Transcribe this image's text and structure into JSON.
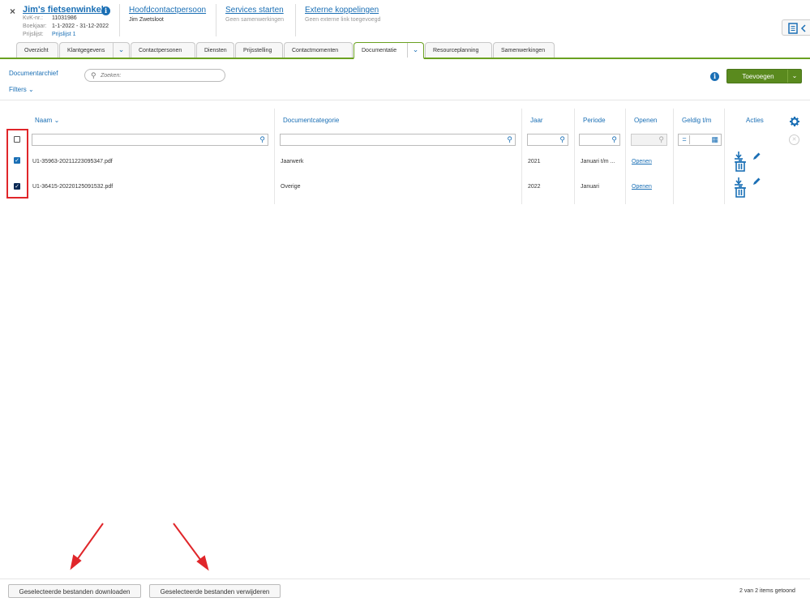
{
  "client": {
    "name": "Jim's fietsenwinkel",
    "kvk_label": "KvK-nr.:",
    "kvk_value": "11031986",
    "boekjaar_label": "Boekjaar:",
    "boekjaar_value": "1-1-2022 - 31-12-2022",
    "prijslijst_label": "Prijslijst:",
    "prijslijst_value": "Prijslijst 1"
  },
  "header": {
    "contact_title": "Hoofdcontactpersoon",
    "contact_name": "Jim Zwetsloot",
    "services_title": "Services starten",
    "services_sub": "Geen samenwerkingen",
    "external_title": "Externe koppelingen",
    "external_sub": "Geen externe link toegevoegd"
  },
  "tabs": [
    {
      "label": "Overzicht"
    },
    {
      "label": "Klantgegevens"
    },
    {
      "label": "Contactpersonen"
    },
    {
      "label": "Diensten"
    },
    {
      "label": "Prijsstelling"
    },
    {
      "label": "Contactmomenten"
    },
    {
      "label": "Documentatie"
    },
    {
      "label": "Resourceplanning"
    },
    {
      "label": "Samenwerkingen"
    }
  ],
  "toolbar": {
    "archive_label": "Documentarchief",
    "search_placeholder": "Zoeken:",
    "filters_label": "Filters",
    "add_label": "Toevoegen"
  },
  "table": {
    "columns": {
      "naam": "Naam",
      "categorie": "Documentcategorie",
      "jaar": "Jaar",
      "periode": "Periode",
      "openen": "Openen",
      "geldig": "Geldig t/m",
      "acties": "Acties"
    },
    "rows": [
      {
        "naam": "U1-35963-20211223095347.pdf",
        "categorie": "Jaarwerk",
        "jaar": "2021",
        "periode": "Januari t/m ...",
        "openen": "Openen",
        "checked": true
      },
      {
        "naam": "U1-36415-20220125091532.pdf",
        "categorie": "Overige",
        "jaar": "2022",
        "periode": "Januari",
        "openen": "Openen",
        "checked": true
      }
    ]
  },
  "footer": {
    "download_label": "Geselecteerde bestanden downloaden",
    "delete_label": "Geselecteerde bestanden verwijderen",
    "count_text": "2 van 2 items getoond"
  },
  "colors": {
    "accent": "#1a6fb5",
    "primary_button": "#5a8a1e",
    "tab_active_border": "#6aa121",
    "highlight": "#e0262a"
  }
}
